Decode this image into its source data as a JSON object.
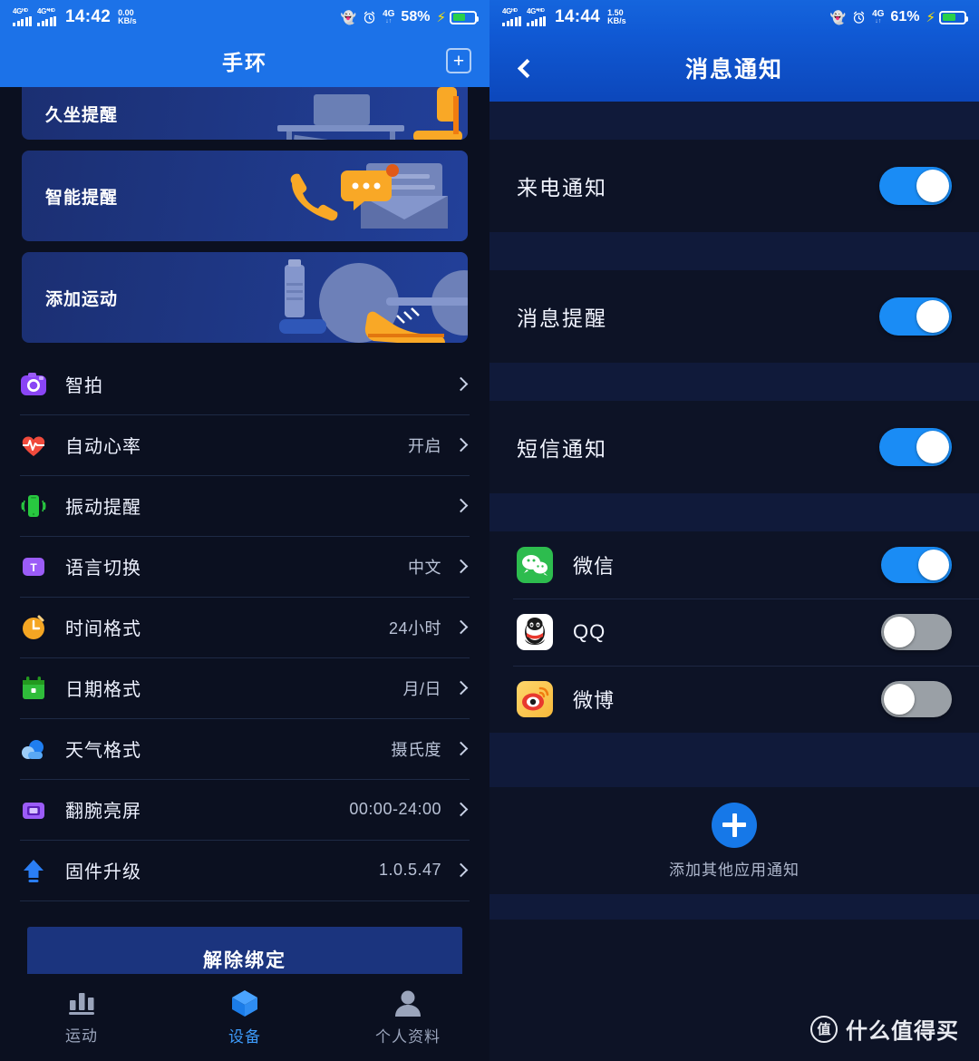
{
  "left": {
    "status": {
      "sim1_tag": "4Gᴴᴰ",
      "sim2_tag": "4G*ᴴᴰ",
      "time": "14:42",
      "speed_value": "0.00",
      "speed_unit": "KB/s",
      "bluetooth_icon": "bluetooth-icon",
      "alarm_icon": "alarm-icon",
      "network": "4G",
      "network_sub": "↓↑",
      "battery_percent": "58%",
      "charging_icon": "charging-bolt-icon"
    },
    "header": {
      "title": "手环",
      "add_icon": "plus-box-icon"
    },
    "cards": [
      {
        "title": "久坐提醒",
        "art": "desk-chair-illustration"
      },
      {
        "title": "智能提醒",
        "art": "phone-message-envelope-illustration"
      },
      {
        "title": "添加运动",
        "art": "dumbbell-shoe-illustration"
      }
    ],
    "list": [
      {
        "label": "智拍",
        "value": "",
        "icon": "camera-icon"
      },
      {
        "label": "自动心率",
        "value": "开启",
        "icon": "heart-rate-icon"
      },
      {
        "label": "振动提醒",
        "value": "",
        "icon": "vibration-phone-icon"
      },
      {
        "label": "语言切换",
        "value": "中文",
        "icon": "translate-icon"
      },
      {
        "label": "时间格式",
        "value": "24小时",
        "icon": "clock-icon"
      },
      {
        "label": "日期格式",
        "value": "月/日",
        "icon": "calendar-icon"
      },
      {
        "label": "天气格式",
        "value": "摄氏度",
        "icon": "cloud-icon"
      },
      {
        "label": "翻腕亮屏",
        "value": "00:00-24:00",
        "icon": "wrist-screen-icon"
      },
      {
        "label": "固件升级",
        "value": "1.0.5.47",
        "icon": "upload-arrow-icon"
      }
    ],
    "unbind_label": "解除绑定",
    "tabs": [
      {
        "label": "运动",
        "icon": "bar-chart-icon",
        "active": false
      },
      {
        "label": "设备",
        "icon": "cube-icon",
        "active": true
      },
      {
        "label": "个人资料",
        "icon": "person-icon",
        "active": false
      }
    ]
  },
  "right": {
    "status": {
      "sim1_tag": "4Gᴴᴰ",
      "sim2_tag": "4G*ᴴᴰ",
      "time": "14:44",
      "speed_value": "1.50",
      "speed_unit": "KB/s",
      "bluetooth_icon": "bluetooth-icon",
      "alarm_icon": "alarm-icon",
      "network": "4G",
      "network_sub": "↓↑",
      "battery_percent": "61%",
      "charging_icon": "charging-bolt-icon"
    },
    "header": {
      "title": "消息通知",
      "back_icon": "back-chevron-icon"
    },
    "notifications": [
      {
        "label": "来电通知",
        "on": true
      },
      {
        "label": "消息提醒",
        "on": true
      },
      {
        "label": "短信通知",
        "on": true
      }
    ],
    "apps": [
      {
        "name": "微信",
        "on": true,
        "icon": "wechat-icon"
      },
      {
        "name": "QQ",
        "on": false,
        "icon": "qq-icon"
      },
      {
        "name": "微博",
        "on": false,
        "icon": "weibo-icon"
      }
    ],
    "add": {
      "label": "添加其他应用通知",
      "icon": "plus-circle-icon"
    },
    "watermark": {
      "badge": "值",
      "text": "什么值得买"
    }
  },
  "colors": {
    "header_blue": "#1c72e8",
    "right_header_blue": "#0c47bb",
    "page_bg": "#0b1020",
    "card_blue": "#22409a",
    "toggle_on": "#1a8cf5",
    "toggle_off": "#9aa0a6",
    "accent_tab": "#3d9bfb"
  }
}
